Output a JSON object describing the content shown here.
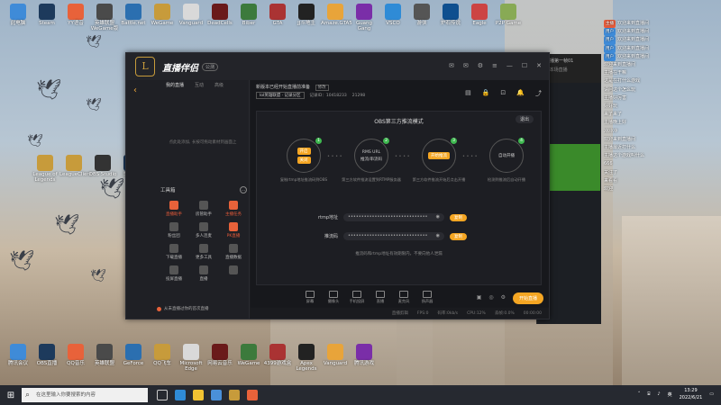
{
  "desktop": {
    "icons_top": [
      "此电脑",
      "Steam",
      "YY语音",
      "英雄联盟WeGame版",
      "Battle.net",
      "WeGame",
      "Vanguard",
      "DeadCells",
      "Biber",
      "GTA",
      "JJ斗地主",
      "Amaze.GTA5",
      "Guang Gang",
      "VSCO",
      "游侠",
      "炉石传说",
      "Eagle",
      "P2P Game"
    ],
    "icons_mid": [
      "League of Legends",
      "LeagueClient",
      "OBS Studio",
      "Steam"
    ],
    "icons_bottom": [
      "腾讯会议",
      "OBS直播",
      "QQ音乐",
      "英雄联盟",
      "GeForce",
      "QQ飞车",
      "Microsoft Edge",
      "网易云音乐",
      "WeGame",
      "4399游戏盒",
      "Apex Legends",
      "Vanguard",
      "腾讯游戏"
    ]
  },
  "chat": {
    "rows": [
      {
        "tag": "主播",
        "tag_color": "#e85b3a",
        "text": "欢迎来到直播间"
      },
      {
        "tag": "用户",
        "tag_color": "#3f8bd8",
        "text": "欢迎来到直播间"
      },
      {
        "tag": "用户",
        "tag_color": "#3f8bd8",
        "text": "欢迎来到直播间"
      },
      {
        "tag": "用户",
        "tag_color": "#3f8bd8",
        "text": "欢迎来到直播间"
      },
      {
        "tag": "用户",
        "tag_color": "#3f8bd8",
        "text": "欢迎来到直播间"
      },
      {
        "tag": "",
        "tag_color": "#000000",
        "text": "欢迎来到直播间"
      },
      {
        "tag": "",
        "tag_color": "#000000",
        "text": "主播在干嘛"
      },
      {
        "tag": "",
        "tag_color": "#000000",
        "text": "这是在打什么游戏"
      },
      {
        "tag": "",
        "tag_color": "#000000",
        "text": "请问这个怎么玩"
      },
      {
        "tag": "",
        "tag_color": "#000000",
        "text": "主播好厉害"
      },
      {
        "tag": "",
        "tag_color": "#000000",
        "text": "好好玩"
      },
      {
        "tag": "",
        "tag_color": "#000000",
        "text": "来了来了"
      },
      {
        "tag": "",
        "tag_color": "#000000",
        "text": "主播晚上好"
      },
      {
        "tag": "",
        "tag_color": "#000000",
        "text": "冲冲冲"
      },
      {
        "tag": "",
        "tag_color": "#000000",
        "text": "欢迎来到直播间"
      },
      {
        "tag": "",
        "tag_color": "#000000",
        "text": "主播最近打什么"
      },
      {
        "tag": "",
        "tag_color": "#000000",
        "text": "主播这个游戏叫什么"
      },
      {
        "tag": "",
        "tag_color": "#000000",
        "text": "666"
      },
      {
        "tag": "",
        "tag_color": "#000000",
        "text": "关注了"
      },
      {
        "tag": "",
        "tag_color": "#000000",
        "text": "来看看"
      },
      {
        "tag": "",
        "tag_color": "#000000",
        "text": "欢迎"
      }
    ]
  },
  "bgwin": {
    "title": "开直播第一帧01",
    "sub": "1/6 本场直播"
  },
  "app": {
    "brand": "直播伴侣",
    "version": "公测",
    "sidebar": {
      "tabs": [
        "我的直播",
        "互动",
        "高级"
      ],
      "empty_text": "点此处添加, 长按可拖动素材到画面上",
      "toolbox_title": "工具箱",
      "tools": [
        {
          "label": "直播助手",
          "hot": true
        },
        {
          "label": "房管助手",
          "hot": false
        },
        {
          "label": "主播任务",
          "hot": true
        },
        {
          "label": "粉丝团",
          "hot": false
        },
        {
          "label": "多人连麦",
          "hot": false
        },
        {
          "label": "PK直播",
          "hot": true
        },
        {
          "label": "下载直播",
          "hot": false
        },
        {
          "label": "更多工具",
          "hot": false
        },
        {
          "label": "直播数据",
          "hot": false
        },
        {
          "label": "投屏直播",
          "hot": false
        },
        {
          "label": "直播",
          "hot": false
        },
        {
          "label": "",
          "hot": false
        }
      ],
      "notice": "从未直播过你的首次直播"
    },
    "room": {
      "title": "新版本已经开始直播前准备",
      "edit_label": "修改",
      "category": "lol英雄联盟 · 记录分区",
      "uid": "记录ID：10418233",
      "fans": "21298"
    },
    "obs": {
      "title": "OBS第三方推流模式",
      "exit": "退出",
      "steps": [
        {
          "num": "1",
          "buttons": [
            "开启",
            "关闭"
          ],
          "text": "",
          "desc": "复制rtmp地址推流码到OBS"
        },
        {
          "num": "2",
          "buttons": [],
          "text": "RMS URL\n推流/串流码",
          "desc": "第三方软件推流设置到RTMP服务器"
        },
        {
          "num": "3",
          "buttons": [
            "开始推流"
          ],
          "text": "",
          "desc": "第三方软件推流开始后点击开播"
        },
        {
          "num": "4",
          "buttons": [],
          "text": "自动开播",
          "desc": "检测到推流后自动开播"
        }
      ],
      "rtmp_label": "rtmp地址",
      "rtmp_value": "••••••••••••••••••••••••••••••",
      "key_label": "推流码",
      "key_value": "••••••••••••••••••••••••••••••",
      "copy_label": "复制",
      "hint": "推流码和rtmp地址有效期限内，不要向他人泄漏"
    },
    "bottom_tools": [
      "屏幕",
      "摄像头",
      "手机投屏",
      "直播",
      "麦克风",
      "扬声器"
    ],
    "start_label": "开始直播",
    "status": [
      "直播剪辑",
      "FPS:0",
      "码率:0kb/s",
      "CPU:12%",
      "丢帧:0.0%",
      "00:00:00"
    ]
  },
  "taskbar": {
    "search_placeholder": "在这里输入你要搜索的内容",
    "time": "13:29",
    "date": "2022/6/21",
    "lang": "英"
  }
}
